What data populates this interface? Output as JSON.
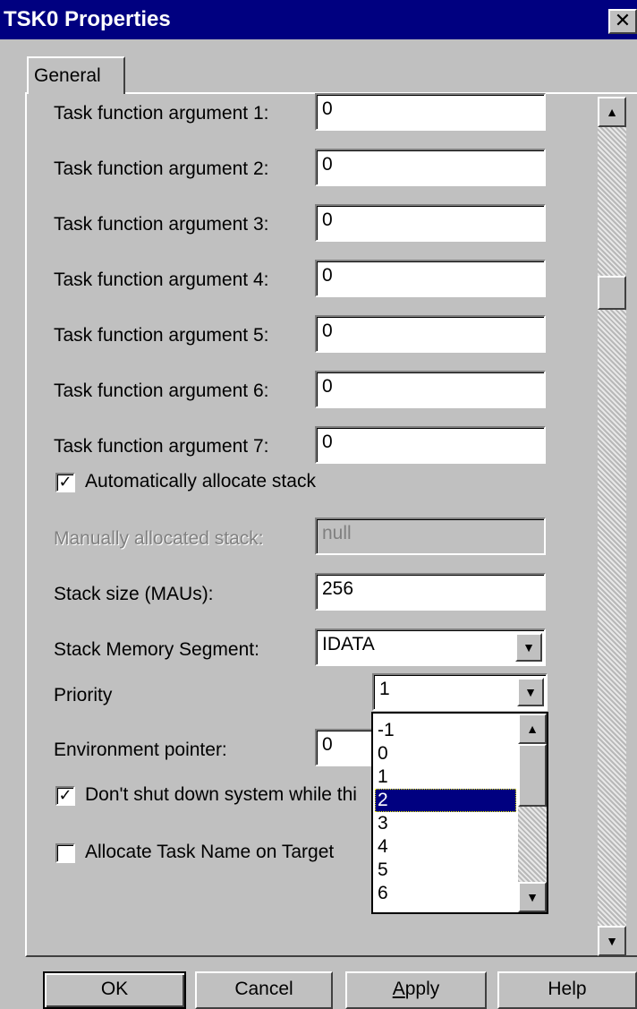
{
  "window": {
    "title": "TSK0 Properties",
    "close_glyph": "✕"
  },
  "tabs": [
    {
      "label": "General"
    }
  ],
  "fields": {
    "arg1": {
      "label": "Task function argument 1:",
      "value": "0"
    },
    "arg2": {
      "label": "Task function argument 2:",
      "value": "0"
    },
    "arg3": {
      "label": "Task function argument 3:",
      "value": "0"
    },
    "arg4": {
      "label": "Task function argument 4:",
      "value": "0"
    },
    "arg5": {
      "label": "Task function argument 5:",
      "value": "0"
    },
    "arg6": {
      "label": "Task function argument 6:",
      "value": "0"
    },
    "arg7": {
      "label": "Task function argument 7:",
      "value": "0"
    },
    "auto_stack": {
      "label": "Automatically allocate stack",
      "checked": true
    },
    "manual_stack": {
      "label": "Manually allocated stack:",
      "value": "null",
      "disabled": true
    },
    "stack_size": {
      "label": "Stack size (MAUs):",
      "value": "256"
    },
    "stack_segment": {
      "label": "Stack Memory Segment:",
      "value": "IDATA"
    },
    "priority": {
      "label": "Priority",
      "value": "1"
    },
    "env_pointer": {
      "label": "Environment pointer:",
      "value": "0"
    },
    "no_shutdown": {
      "label": "Don't shut down system while thi",
      "checked": true
    },
    "task_name": {
      "label": "Allocate Task Name on Target",
      "checked": false
    }
  },
  "priority_dropdown": {
    "options": [
      "-1",
      "0",
      "1",
      "2",
      "3",
      "4",
      "5",
      "6"
    ],
    "selected": "2"
  },
  "glyphs": {
    "up": "▲",
    "down": "▼",
    "check": "✓"
  },
  "buttons": {
    "ok": "OK",
    "cancel": "Cancel",
    "apply_accel": "A",
    "apply_rest": "pply",
    "help": "Help"
  },
  "colors": {
    "titlebar": "#000080",
    "face": "#c0c0c0",
    "selection": "#000080"
  }
}
